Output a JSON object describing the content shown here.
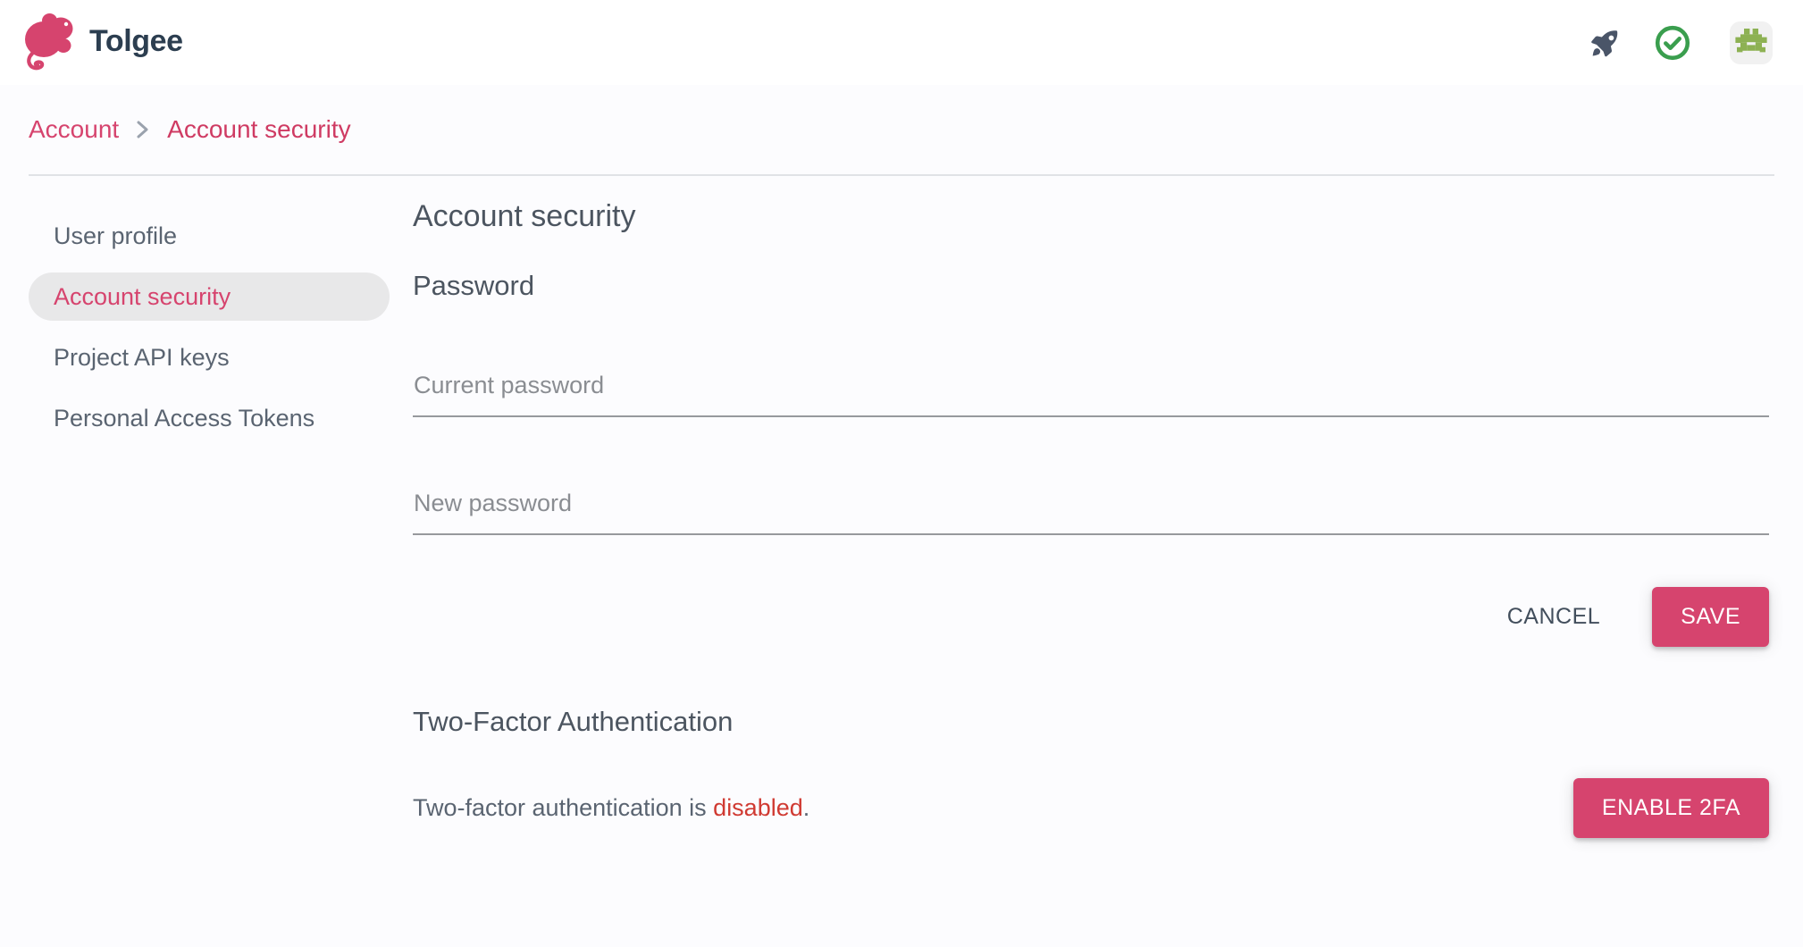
{
  "brand": {
    "name": "Tolgee",
    "logo_icon": "tolgee-mouse-logo",
    "logo_color": "#d6446e",
    "wordmark_color": "#2c3e50"
  },
  "topbar": {
    "actions": [
      {
        "icon": "rocket-icon",
        "label": "Quick start",
        "color": "#4a5568"
      },
      {
        "icon": "check-circle-icon",
        "label": "Task done",
        "color": "#3a9e4e"
      },
      {
        "icon": "user-avatar-identicon",
        "label": "User menu",
        "color": "#8db153"
      }
    ]
  },
  "breadcrumb": {
    "items": [
      {
        "label": "Account",
        "current": false
      },
      {
        "label": "Account security",
        "current": true
      }
    ],
    "separator": "›",
    "link_color": "#d6446e"
  },
  "sidebar": {
    "items": [
      {
        "label": "User profile",
        "active": false
      },
      {
        "label": "Account security",
        "active": true
      },
      {
        "label": "Project API keys",
        "active": false
      },
      {
        "label": "Personal Access Tokens",
        "active": false
      }
    ],
    "active_bg": "#e8e8e9",
    "active_color": "#d6446e"
  },
  "main": {
    "page_title": "Account security",
    "password_section": {
      "title": "Password",
      "current_password": {
        "placeholder": "Current password",
        "value": ""
      },
      "new_password": {
        "placeholder": "New password",
        "value": ""
      },
      "cancel_label": "CANCEL",
      "save_label": "SAVE"
    },
    "tfa_section": {
      "title": "Two-Factor Authentication",
      "status_prefix": "Two-factor authentication is ",
      "status_state": "disabled",
      "status_suffix": ".",
      "state_color": "#d03a32",
      "enable_label": "ENABLE 2FA"
    }
  },
  "colors": {
    "accent": "#d6446e",
    "text": "#5a6471",
    "heading": "#4c5560",
    "page_bg": "#fcfcfe",
    "divider": "#e0e2e6"
  }
}
